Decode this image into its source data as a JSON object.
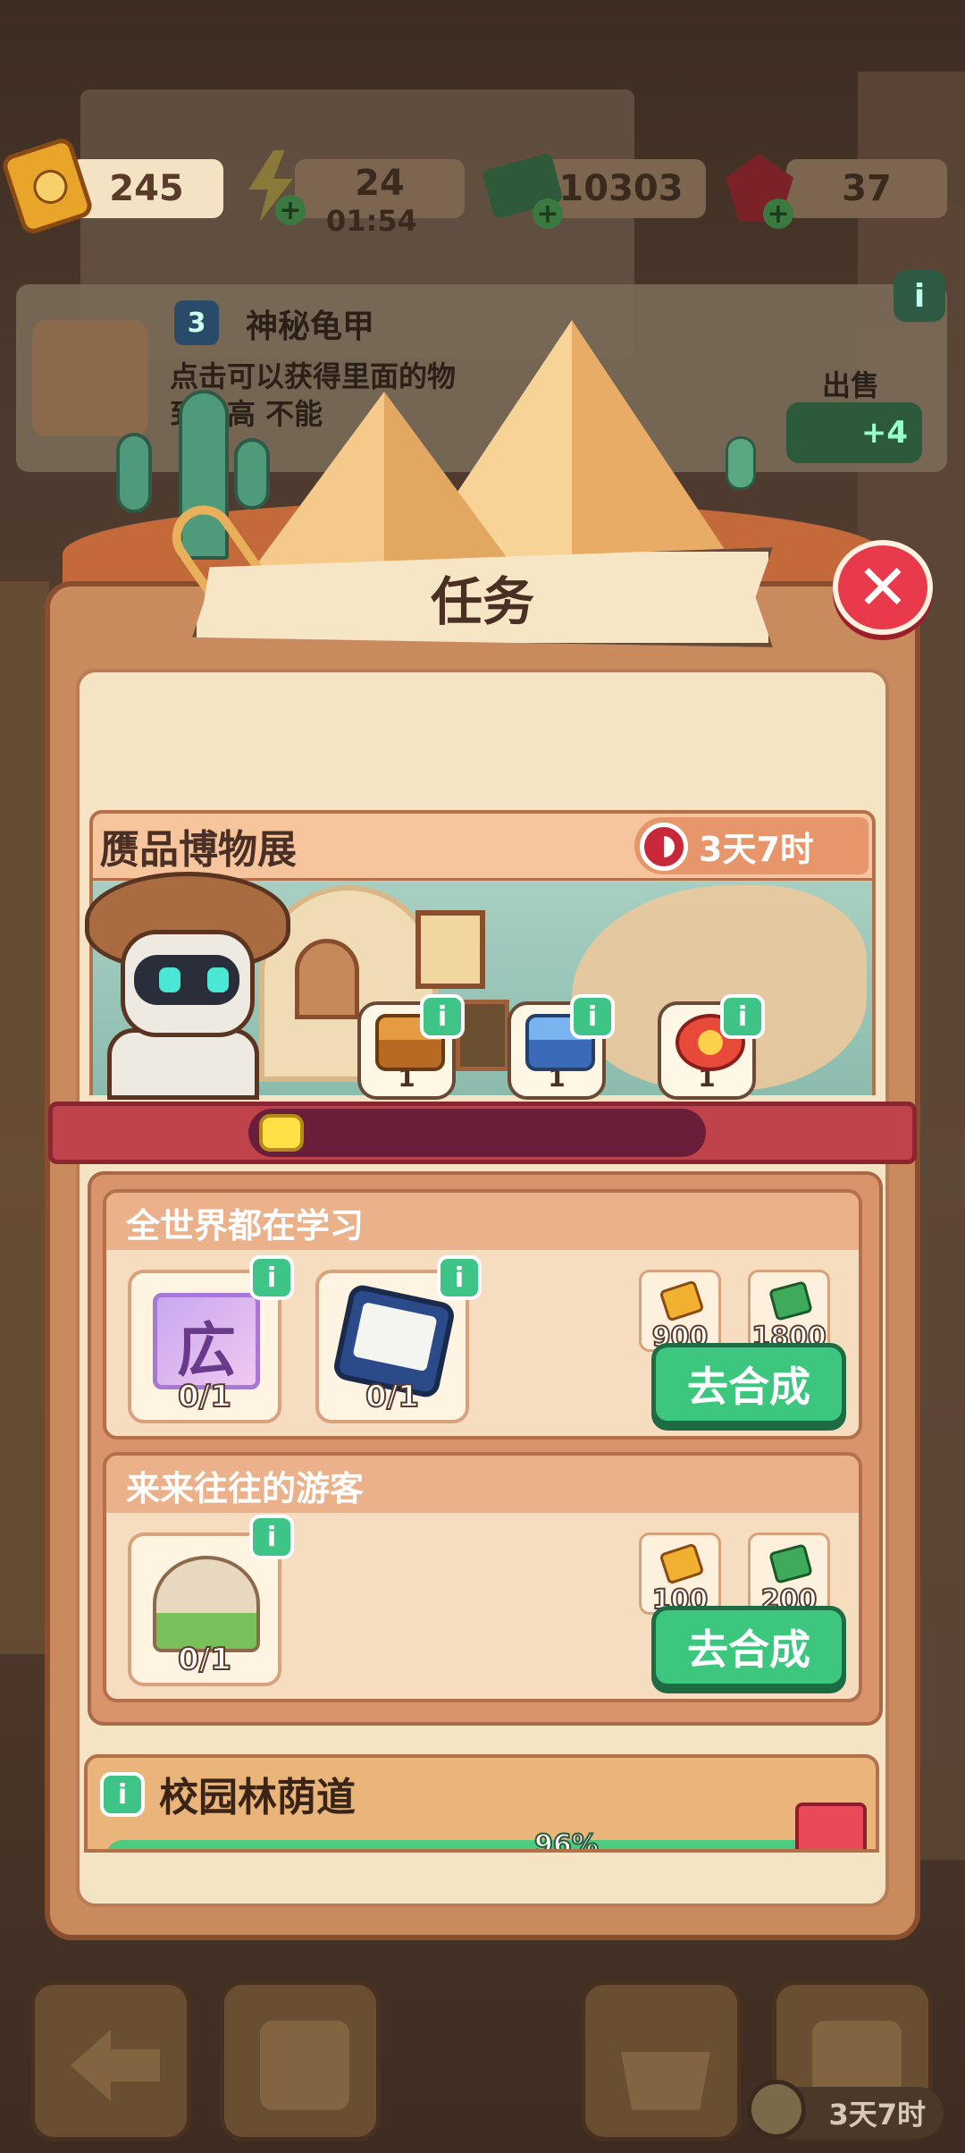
{
  "resources": {
    "tickets": "245",
    "energy": "24",
    "energy_timer": "01:54",
    "cash": "10303",
    "gems": "37"
  },
  "background_card": {
    "level": "3",
    "title": "神秘龟甲",
    "description": "点击可以获得里面的物 到最高 不能",
    "sell_label": "出售",
    "sell_value": "+4"
  },
  "dialog": {
    "title": "任务",
    "close_icon": "close-icon"
  },
  "event": {
    "title": "赝品博物展",
    "timer": "3天7时",
    "rewards": [
      {
        "icon": "wooden-chest-icon",
        "count": "1"
      },
      {
        "icon": "blue-chest-icon",
        "count": "1"
      },
      {
        "icon": "red-gift-chest-icon",
        "count": "1"
      }
    ],
    "progress": 0.07
  },
  "tasks": [
    {
      "title": "全世界都在学习",
      "requirements": [
        {
          "icon": "poster-icon",
          "glyph": "広",
          "count": "0/1"
        },
        {
          "icon": "ebook-reader-icon",
          "count": "0/1"
        }
      ],
      "prizes": [
        {
          "icon": "ticket-icon",
          "value": "900"
        },
        {
          "icon": "cash-icon",
          "value": "1800"
        }
      ],
      "button": "去合成"
    },
    {
      "title": "来来往往的游客",
      "requirements": [
        {
          "icon": "taj-mahal-icon",
          "count": "0/1"
        }
      ],
      "prizes": [
        {
          "icon": "ticket-icon",
          "value": "100"
        },
        {
          "icon": "cash-icon",
          "value": "200"
        }
      ],
      "button": "去合成"
    }
  ],
  "campus": {
    "title": "校园林荫道",
    "percent_text": "96%",
    "progress": 0.96
  },
  "info_glyph": "i",
  "bottom_timer": "3天7时",
  "colors": {
    "accent_green": "#3cc67e",
    "close_red": "#e83a4a",
    "panel_brown": "#c98b5e"
  }
}
